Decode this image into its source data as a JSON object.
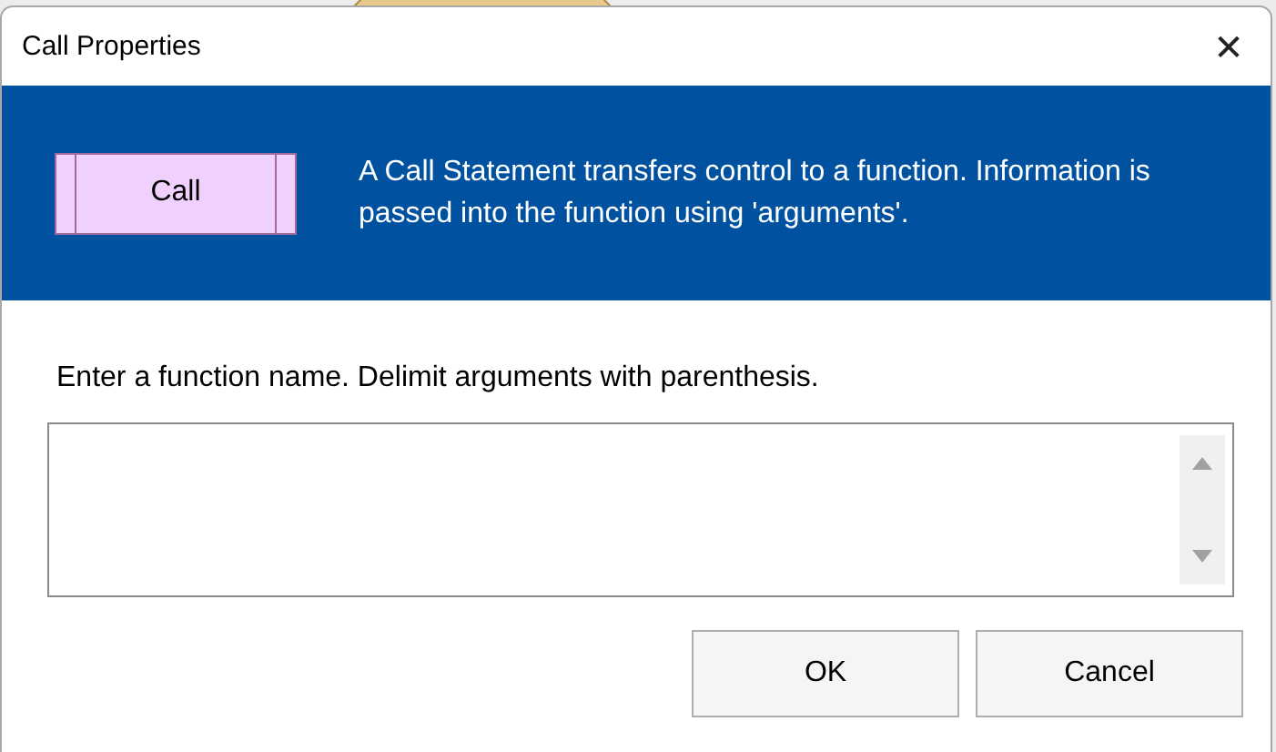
{
  "window": {
    "title": "Call Properties",
    "close": "✕"
  },
  "header": {
    "symbol_label": "Call",
    "description": "A Call Statement transfers control to a function. Information is passed into the function using 'arguments'."
  },
  "prompt": "Enter a function name. Delimit arguments with parenthesis.",
  "buttons": [
    {
      "label": "OK"
    },
    {
      "label": "Cancel"
    }
  ]
}
